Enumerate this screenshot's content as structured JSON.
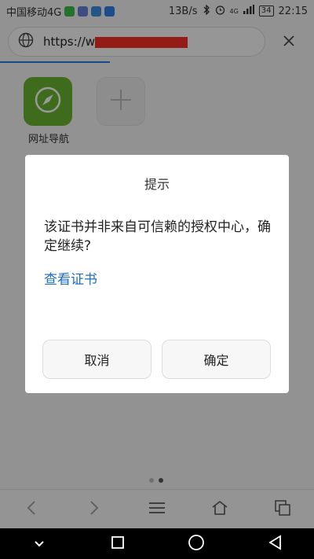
{
  "status_bar": {
    "carrier": "中国移动4G",
    "speed": "13B/s",
    "network": "4G",
    "battery": "34",
    "time": "22:15"
  },
  "address_bar": {
    "url_prefix": "https://w"
  },
  "shortcuts": [
    {
      "label": "网址导航"
    }
  ],
  "dialog": {
    "title": "提示",
    "message": "该证书并非来自可信赖的授权中心，确定继续?",
    "link": "查看证书",
    "cancel": "取消",
    "ok": "确定"
  },
  "colors": {
    "accent": "#2a7de1",
    "link": "#1f6dc6",
    "shortcut_green": "#6ab52f",
    "redaction": "#f52f25"
  },
  "icons": {
    "address": "globe-icon",
    "close": "close-icon",
    "shortcut": "compass-icon",
    "add": "plus-icon",
    "toolbar": [
      "back-icon",
      "forward-icon",
      "menu-icon",
      "home-icon",
      "tabs-icon"
    ],
    "nav": [
      "collapse-icon",
      "recent-apps-icon",
      "home-circle-icon",
      "back-triangle-icon"
    ]
  }
}
